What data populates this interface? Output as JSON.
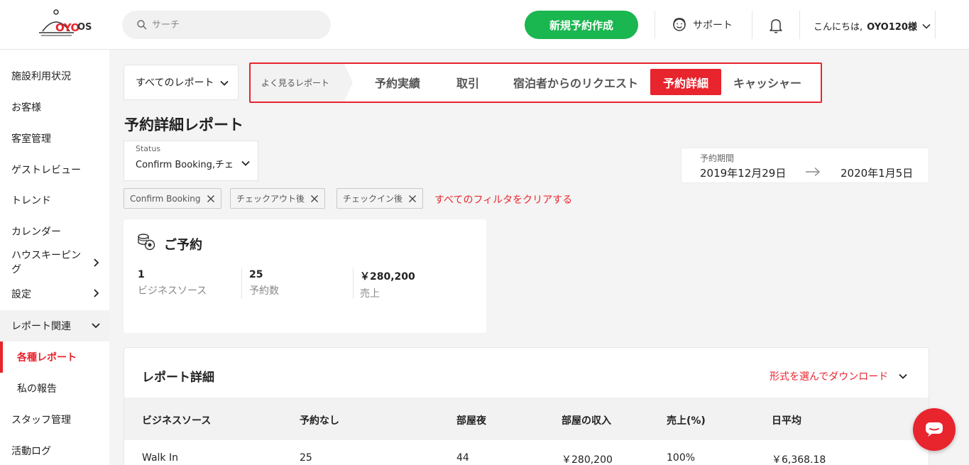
{
  "header": {
    "logo_text": "OYO",
    "logo_suffix": "OS",
    "search_placeholder": "サーチ",
    "new_booking_label": "新規予約作成",
    "support_label": "サポート",
    "greeting_prefix": "こんにちは, ",
    "greeting_name": "OYO120様"
  },
  "sidebar": {
    "items": [
      {
        "label": "施設利用状況"
      },
      {
        "label": "お客様"
      },
      {
        "label": "客室管理"
      },
      {
        "label": "ゲストレビュー"
      },
      {
        "label": "トレンド"
      },
      {
        "label": "カレンダー"
      },
      {
        "label": "ハウスキーピング"
      },
      {
        "label": "設定"
      },
      {
        "label": "レポート関連"
      },
      {
        "label": "各種レポート"
      },
      {
        "label": "私の報告"
      },
      {
        "label": "スタッフ管理"
      },
      {
        "label": "活動ログ"
      }
    ]
  },
  "report_select": {
    "label": "すべてのレポート"
  },
  "tabs": {
    "lead": "よく見るレポート",
    "items": [
      {
        "label": "予約実績"
      },
      {
        "label": "取引"
      },
      {
        "label": "宿泊者からのリクエスト"
      },
      {
        "label": "予約詳細"
      },
      {
        "label": "キャッシャー"
      }
    ],
    "active_index": 3
  },
  "page_title": "予約詳細レポート",
  "status_filter": {
    "label": "Status",
    "value": "Confirm Booking,チェ"
  },
  "date_range": {
    "label": "予約期間",
    "start": "2019年12月29日",
    "end": "2020年1月5日"
  },
  "chips": [
    {
      "label": "Confirm Booking"
    },
    {
      "label": "チェックアウト後"
    },
    {
      "label": "チェックイン後"
    }
  ],
  "clear_filters": "すべてのフィルタをクリアする",
  "summary_card": {
    "title": "ご予約",
    "stats": [
      {
        "value": "1",
        "label": "ビジネスソース"
      },
      {
        "value": "25",
        "label": "予約数"
      },
      {
        "value": "￥280,200",
        "label": "売上"
      }
    ]
  },
  "details": {
    "title": "レポート詳細",
    "download_label": "形式を選んでダウンロード",
    "columns": [
      "ビジネスソース",
      "予約なし",
      "部屋夜",
      "部屋の収入",
      "売上(%)",
      "日平均"
    ],
    "rows": [
      [
        "Walk In",
        "25",
        "44",
        "￥280,200",
        "100%",
        "￥6,368.18"
      ]
    ]
  },
  "colors": {
    "accent": "#e8242d",
    "primary_green": "#1ab64f"
  }
}
